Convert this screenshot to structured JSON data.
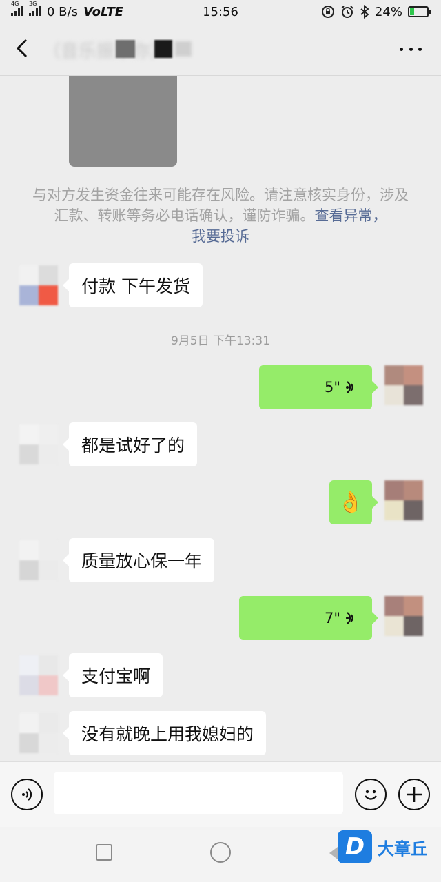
{
  "status_bar": {
    "net_a": "4G",
    "net_b": "3G",
    "speed": "0 B/s",
    "volte": "VoLTE",
    "time": "15:56",
    "battery": "24%"
  },
  "nav": {
    "title": "（音乐振东你）"
  },
  "warning": {
    "text": "与对方发生资金往来可能存在风险。请注意核实身份，涉及汇款、转账等务必电话确认，谨防诈骗。",
    "link_anomaly": "查看异常，",
    "link_report": "我要投诉"
  },
  "messages": [
    {
      "side": "in",
      "text": "付款 下午发货"
    },
    {
      "side": "time",
      "text": "9月5日 下午13:31"
    },
    {
      "side": "out",
      "type": "voice",
      "text": "5\""
    },
    {
      "side": "in",
      "text": "都是试好了的"
    },
    {
      "side": "out",
      "type": "emoji",
      "text": "👌"
    },
    {
      "side": "in",
      "text": "质量放心保一年"
    },
    {
      "side": "out",
      "type": "voice",
      "text": "7\""
    },
    {
      "side": "in",
      "text": "支付宝啊"
    },
    {
      "side": "in",
      "text": "没有就晚上用我媳妇的"
    }
  ],
  "watermark": {
    "logo": "D",
    "text": "大章丘"
  },
  "colors": {
    "bubble_out": "#95ec69",
    "bubble_in": "#ffffff",
    "link": "#576b95",
    "background": "#ededed"
  }
}
